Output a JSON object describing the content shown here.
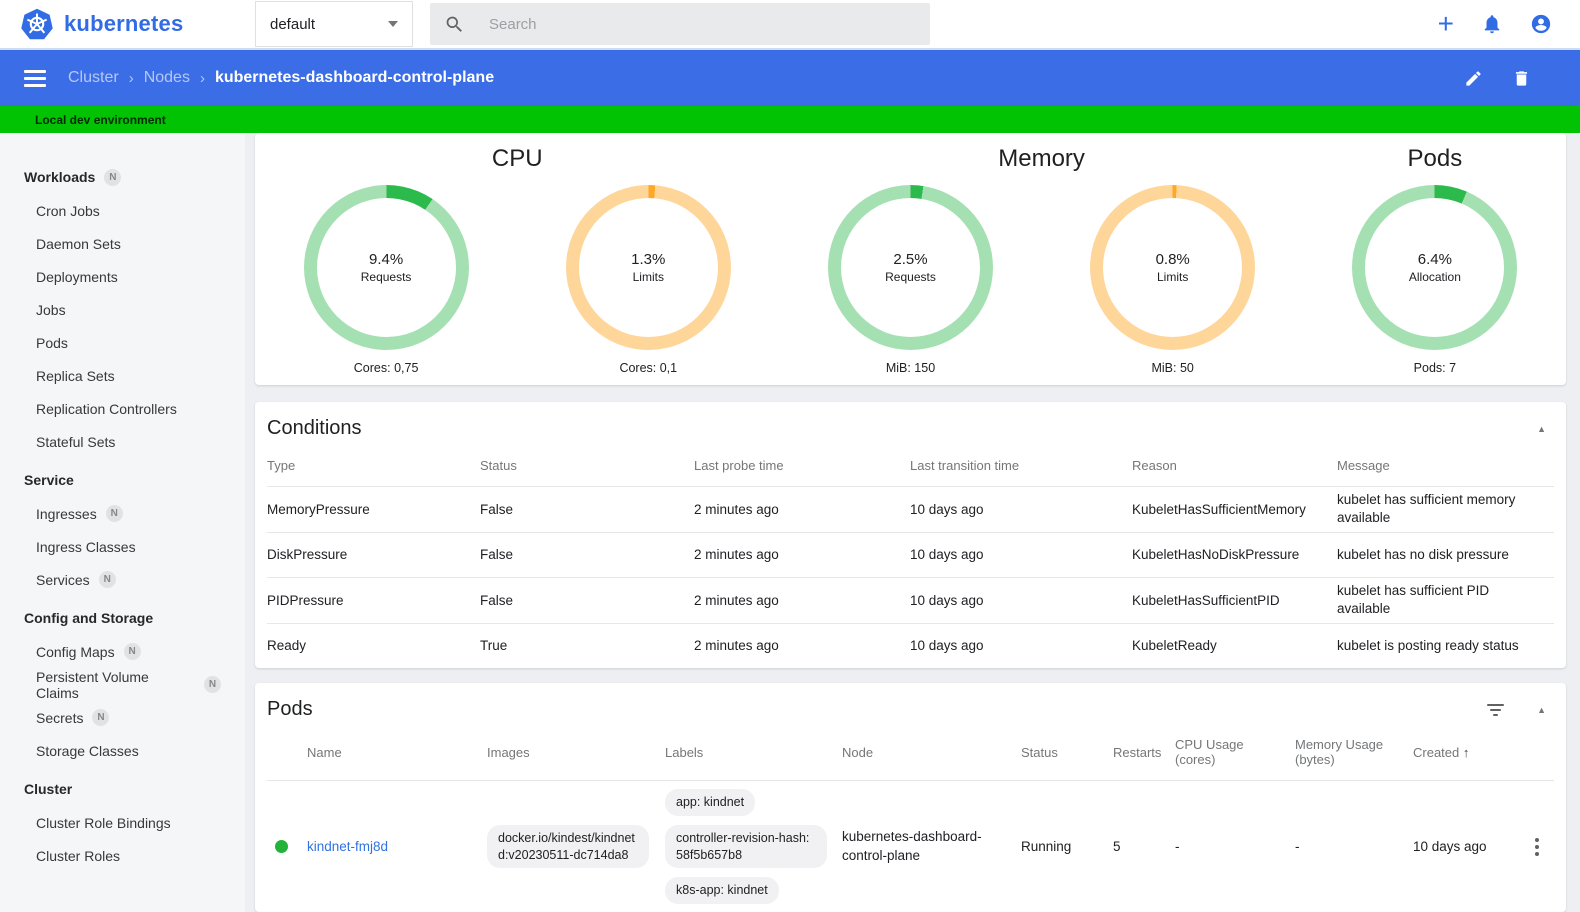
{
  "header": {
    "logo_text": "kubernetes",
    "namespace": "default",
    "search_placeholder": "Search"
  },
  "icons": [
    "kubernetes-logo-icon",
    "dropdown-caret-icon",
    "search-icon",
    "plus-icon",
    "bell-icon",
    "account-icon",
    "hamburger-icon",
    "edit-pencil-icon",
    "delete-trash-icon",
    "filter-icon",
    "collapse-up-icon",
    "kebab-menu-icon",
    "sort-up-icon",
    "status-dot-icon"
  ],
  "toolbar": {
    "breadcrumbs": [
      "Cluster",
      "Nodes"
    ],
    "separator": "›",
    "current": "kubernetes-dashboard-control-plane"
  },
  "banner": {
    "text": "Local dev environment"
  },
  "sidebar": {
    "sections": [
      {
        "header": "Workloads",
        "badge": "N",
        "items": [
          {
            "label": "Cron Jobs"
          },
          {
            "label": "Daemon Sets"
          },
          {
            "label": "Deployments"
          },
          {
            "label": "Jobs"
          },
          {
            "label": "Pods"
          },
          {
            "label": "Replica Sets"
          },
          {
            "label": "Replication Controllers"
          },
          {
            "label": "Stateful Sets"
          }
        ]
      },
      {
        "header": "Service",
        "items": [
          {
            "label": "Ingresses",
            "badge": "N"
          },
          {
            "label": "Ingress Classes"
          },
          {
            "label": "Services",
            "badge": "N"
          }
        ]
      },
      {
        "header": "Config and Storage",
        "items": [
          {
            "label": "Config Maps",
            "badge": "N"
          },
          {
            "label": "Persistent Volume Claims",
            "badge": "N"
          },
          {
            "label": "Secrets",
            "badge": "N"
          },
          {
            "label": "Storage Classes"
          }
        ]
      },
      {
        "header": "Cluster",
        "items": [
          {
            "label": "Cluster Role Bindings"
          },
          {
            "label": "Cluster Roles"
          }
        ]
      }
    ]
  },
  "overview": {
    "groups": [
      {
        "title": "CPU",
        "donuts": [
          {
            "percent": "9.4%",
            "label": "Requests",
            "caption": "Cores: 0,75",
            "value": 9.4,
            "palette": "green"
          },
          {
            "percent": "1.3%",
            "label": "Limits",
            "caption": "Cores: 0,1",
            "value": 1.3,
            "palette": "orange"
          }
        ]
      },
      {
        "title": "Memory",
        "donuts": [
          {
            "percent": "2.5%",
            "label": "Requests",
            "caption": "MiB: 150",
            "value": 2.5,
            "palette": "green"
          },
          {
            "percent": "0.8%",
            "label": "Limits",
            "caption": "MiB: 50",
            "value": 0.8,
            "palette": "orange"
          }
        ]
      },
      {
        "title": "Pods",
        "donuts": [
          {
            "percent": "6.4%",
            "label": "Allocation",
            "caption": "Pods: 7",
            "value": 6.4,
            "palette": "green"
          }
        ]
      }
    ]
  },
  "chart_data": {
    "type": "pie",
    "title": "Node resource allocation donuts",
    "series": [
      {
        "name": "CPU Requests",
        "value_pct": 9.4,
        "caption": "Cores: 0,75"
      },
      {
        "name": "CPU Limits",
        "value_pct": 1.3,
        "caption": "Cores: 0,1"
      },
      {
        "name": "Memory Requests",
        "value_pct": 2.5,
        "caption": "MiB: 150"
      },
      {
        "name": "Memory Limits",
        "value_pct": 0.8,
        "caption": "MiB: 50"
      },
      {
        "name": "Pods Allocation",
        "value_pct": 6.4,
        "caption": "Pods: 7"
      }
    ]
  },
  "conditions": {
    "title": "Conditions",
    "columns": [
      "Type",
      "Status",
      "Last probe time",
      "Last transition time",
      "Reason",
      "Message"
    ],
    "rows": [
      {
        "type": "MemoryPressure",
        "status": "False",
        "probe": "2 minutes ago",
        "transition": "10 days ago",
        "reason": "KubeletHasSufficientMemory",
        "message": "kubelet has sufficient memory available"
      },
      {
        "type": "DiskPressure",
        "status": "False",
        "probe": "2 minutes ago",
        "transition": "10 days ago",
        "reason": "KubeletHasNoDiskPressure",
        "message": "kubelet has no disk pressure"
      },
      {
        "type": "PIDPressure",
        "status": "False",
        "probe": "2 minutes ago",
        "transition": "10 days ago",
        "reason": "KubeletHasSufficientPID",
        "message": "kubelet has sufficient PID available"
      },
      {
        "type": "Ready",
        "status": "True",
        "probe": "2 minutes ago",
        "transition": "10 days ago",
        "reason": "KubeletReady",
        "message": "kubelet is posting ready status"
      }
    ]
  },
  "pods": {
    "title": "Pods",
    "columns": [
      "Name",
      "Images",
      "Labels",
      "Node",
      "Status",
      "Restarts",
      "CPU Usage (cores)",
      "Memory Usage (bytes)",
      "Created"
    ],
    "sort_arrow": "↑",
    "row": {
      "name": "kindnet-fmj8d",
      "image": "docker.io/kindest/kindnetd:v20230511-dc714da8",
      "labels": [
        "app: kindnet",
        "controller-revision-hash: 58f5b657b8",
        "k8s-app: kindnet"
      ],
      "node": "kubernetes-dashboard-control-plane",
      "status": "Running",
      "restarts": "5",
      "cpu": "-",
      "memory": "-",
      "created": "10 days ago"
    }
  },
  "colors": {
    "green": {
      "arc": "#2cba4c",
      "track": "#a5e0b2"
    },
    "orange": {
      "arc": "#ffa726",
      "track": "#ffd699"
    },
    "accent_blue": "#326ce5",
    "toolbar_blue": "#3b6de6",
    "banner_green": "#02c204",
    "status_green": "#23b33a",
    "link_blue": "#3272e2"
  }
}
